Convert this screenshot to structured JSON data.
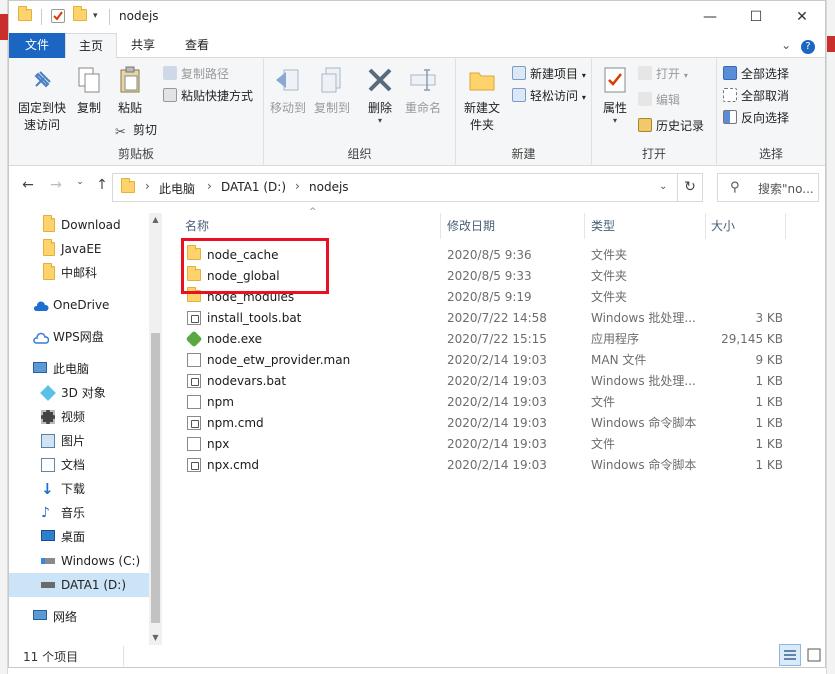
{
  "window": {
    "title": "nodejs"
  },
  "tabs": [
    "文件",
    "主页",
    "共享",
    "查看"
  ],
  "ribbon": {
    "clipboard": {
      "label": "剪贴板",
      "pin": "固定到快速访问",
      "copy": "复制",
      "paste": "粘贴",
      "copy_path": "复制路径",
      "paste_shortcut": "粘贴快捷方式",
      "cut": "剪切"
    },
    "organize": {
      "label": "组织",
      "move_to": "移动到",
      "copy_to": "复制到",
      "delete": "删除",
      "rename": "重命名"
    },
    "new": {
      "label": "新建",
      "new_folder": "新建文件夹",
      "new_item": "新建项目",
      "easy_access": "轻松访问"
    },
    "open": {
      "label": "打开",
      "properties": "属性",
      "open": "打开",
      "edit": "编辑",
      "history": "历史记录"
    },
    "select": {
      "label": "选择",
      "select_all": "全部选择",
      "select_none": "全部取消",
      "invert": "反向选择"
    }
  },
  "address": {
    "crumbs": [
      "此电脑",
      "DATA1 (D:)",
      "nodejs"
    ],
    "search_placeholder": "搜索\"no..."
  },
  "nav": [
    {
      "label": "Download",
      "icon": "folder-icon"
    },
    {
      "label": "JavaEE",
      "icon": "folder-icon"
    },
    {
      "label": "中邮科",
      "icon": "folder-icon"
    },
    {
      "label": "OneDrive",
      "icon": "cloud-icon"
    },
    {
      "label": "WPS网盘",
      "icon": "cloud-icon"
    },
    {
      "label": "此电脑",
      "icon": "computer-icon"
    },
    {
      "label": "3D 对象",
      "icon": "cube-icon"
    },
    {
      "label": "视频",
      "icon": "video-icon"
    },
    {
      "label": "图片",
      "icon": "picture-icon"
    },
    {
      "label": "文档",
      "icon": "document-icon"
    },
    {
      "label": "下载",
      "icon": "download-icon"
    },
    {
      "label": "音乐",
      "icon": "music-icon"
    },
    {
      "label": "桌面",
      "icon": "desktop-icon"
    },
    {
      "label": "Windows (C:)",
      "icon": "drive-icon"
    },
    {
      "label": "DATA1 (D:)",
      "icon": "drive-icon"
    },
    {
      "label": "网络",
      "icon": "network-icon"
    }
  ],
  "columns": {
    "name": "名称",
    "date": "修改日期",
    "type": "类型",
    "size": "大小"
  },
  "files": [
    {
      "name": "node_cache",
      "date": "2020/8/5 9:36",
      "type": "文件夹",
      "size": "",
      "icon": "folder-icon"
    },
    {
      "name": "node_global",
      "date": "2020/8/5 9:33",
      "type": "文件夹",
      "size": "",
      "icon": "folder-icon"
    },
    {
      "name": "node_modules",
      "date": "2020/8/5 9:19",
      "type": "文件夹",
      "size": "",
      "icon": "folder-icon"
    },
    {
      "name": "install_tools.bat",
      "date": "2020/7/22 14:58",
      "type": "Windows 批处理...",
      "size": "3 KB",
      "icon": "batch-file-icon"
    },
    {
      "name": "node.exe",
      "date": "2020/7/22 15:15",
      "type": "应用程序",
      "size": "29,145 KB",
      "icon": "node-exe-icon"
    },
    {
      "name": "node_etw_provider.man",
      "date": "2020/2/14 19:03",
      "type": "MAN 文件",
      "size": "9 KB",
      "icon": "file-icon"
    },
    {
      "name": "nodevars.bat",
      "date": "2020/2/14 19:03",
      "type": "Windows 批处理...",
      "size": "1 KB",
      "icon": "batch-file-icon"
    },
    {
      "name": "npm",
      "date": "2020/2/14 19:03",
      "type": "文件",
      "size": "1 KB",
      "icon": "file-icon"
    },
    {
      "name": "npm.cmd",
      "date": "2020/2/14 19:03",
      "type": "Windows 命令脚本",
      "size": "1 KB",
      "icon": "batch-file-icon"
    },
    {
      "name": "npx",
      "date": "2020/2/14 19:03",
      "type": "文件",
      "size": "1 KB",
      "icon": "file-icon"
    },
    {
      "name": "npx.cmd",
      "date": "2020/2/14 19:03",
      "type": "Windows 命令脚本",
      "size": "1 KB",
      "icon": "batch-file-icon"
    }
  ],
  "status": {
    "count": "11 个项目"
  },
  "colors": {
    "accent": "#1a66c2",
    "highlight": "#e81123",
    "selected": "#cce4f7"
  }
}
